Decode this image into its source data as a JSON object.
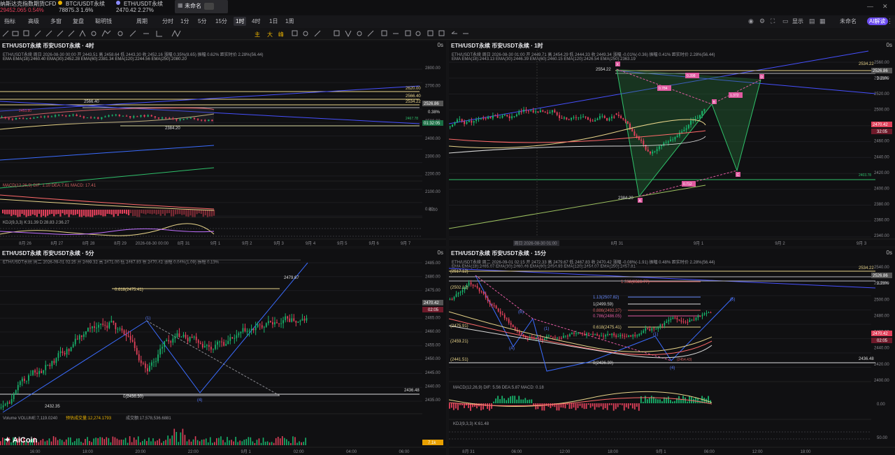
{
  "tickers": [
    {
      "name": "纳斯达克指数期货CFD",
      "price": "29452.065",
      "change": "0.54%",
      "color": "#e0405a"
    },
    {
      "name": "BTC/USDT永续",
      "price": "78875.3",
      "change": "1.6%",
      "color": "#d0d0d4"
    },
    {
      "name": "ETH/USDT永续",
      "price": "2470.42",
      "change": "2.27%",
      "color": "#d0d0d4"
    }
  ],
  "tab": {
    "label": "未命名"
  },
  "toolbar": {
    "items": [
      "指标",
      "高级",
      "多窗",
      "复盘",
      "聪明钱"
    ],
    "period": "周期",
    "timeframes": [
      "分时",
      "1分",
      "5分",
      "15分",
      "1时",
      "4时",
      "1日",
      "1周"
    ],
    "active_tf": "1时",
    "display": "显示",
    "layout": "未命名",
    "ai": "AI解读"
  },
  "panels": [
    {
      "title": "ETH/USDT永续 币安USDT永续 · 4时",
      "zoom": "0s",
      "info": "ETH/USDT永续  周日 2026-08-30 00:00  开 2443.51  高 2458.64  低 2443.30  收 2452.16  涨幅 0.35%(8.65)  振幅 0.62%  距实时价 2.28%(56.44)",
      "ema": "EMA  EMA(18):2460.40  EMA(30):2452.28  EMA(60):2381.34  EMA(120):2244.56  EMA(250):2080.20",
      "yticks": [
        "2800.00",
        "2700.00",
        "2600.00",
        "2500.00",
        "2400.00",
        "2300.00",
        "2200.00",
        "2100.00",
        "0.00"
      ],
      "xticks": [
        "8月 26",
        "8月 27",
        "8月 28",
        "8月 29",
        "2026-08-30 00:00",
        "8月 31",
        "9月 1",
        "9月 2",
        "9月 3",
        "9月 4",
        "9月 5",
        "9月 6",
        "9月 7"
      ],
      "labels": {
        "h": "2566.40",
        "l": "2384.20",
        "lvl1": "2620.00",
        "lvl2": "2566.40",
        "lvl3": "2534.22",
        "cur": "2526.86",
        "pct": "0.38%",
        "cd": "01:32:05",
        "lowp": "2467.78",
        "mid": "2453.80"
      },
      "macd": "MACD(12,26,9)  DIF: 1.10  DEA:7.61  MACD: 17.41",
      "kdj": "KDJ(9,3,3)  K:31.39  D:28.83  J:36.27"
    },
    {
      "title": "ETH/USDT永续 币安USDT永续 · 1时",
      "zoom": "0s",
      "info": "ETH/USDT永续  周日 2026-08-30 01:00  开 2449.71  高 2454.29  低 2444.33  收 2449.34  涨幅 -0.01%(-0.36)  振幅 0.41%  距实时价 2.28%(56.44)",
      "ema": "EMA  EMA(18):2443.13  EMA(30):2446.39  EMA(60):2460.15  EMA(120):2426.54  EMA(250):2363.19",
      "yticks": [
        "2560.00",
        "2540.00",
        "2520.00",
        "2500.00",
        "2480.00",
        "2460.00",
        "2440.00",
        "2420.00",
        "2400.00",
        "2380.00",
        "2360.00",
        "2340.00"
      ],
      "xticks": [
        "周日 2026-08-30 01:00",
        "8月 31",
        "9月 1",
        "9月 2",
        "9月 3"
      ],
      "labels": {
        "h": "2554.22",
        "l": "2384.20",
        "p1": "0.398",
        "p2": "0.784",
        "p3": "1.372",
        "p4": "0.712",
        "X": "X",
        "A": "A",
        "B": "B",
        "C": "C",
        "D": "D",
        "top": "2534.22",
        "cur": "2526.86",
        "pct": "2.28%",
        "price": "2470.42",
        "cd": "32:05",
        "low": "2403.78"
      }
    },
    {
      "title": "ETH/USDT永续 币安USDT永续 · 5分",
      "zoom": "0s",
      "info": "ETH/USDT永续  周二 2026-09-01 02:25  开 2469.32  高 2471.00  低 2467.83  收 2470.42  涨幅 0.04%(1.09)  振幅 0.13%",
      "yticks": [
        "2485.00",
        "2480.00",
        "2475.00",
        "2470.00",
        "2465.00",
        "2460.00",
        "2455.00",
        "2450.00",
        "2445.00",
        "2440.00",
        "2435.00"
      ],
      "xticks": [
        "16:00",
        "18:00",
        "20:00",
        "22:00",
        "9月 1",
        "02:00",
        "04:00",
        "06:00"
      ],
      "labels": {
        "fib618": "0.618(2475.41)",
        "fib0": "0(2436.30)",
        "hi": "2479.67",
        "lo": "2432.35",
        "w1": "(1)",
        "w4": "(4)",
        "cur": "2470.42",
        "cd": "02:05",
        "lvl": "2436.48",
        "vol": "7.1k"
      },
      "volume": "Volume  VOLUME:7,119.0240",
      "vol2": "预估成交量:12,274.1793",
      "vol3": "成交额:17,578,536.6881"
    },
    {
      "title": "ETH/USDT永续 币安USDT永续 · 15分",
      "zoom": "0s",
      "info": "ETH/USDT永续  周二 2026-09-01 02:15  开 2472.33  高 2479.67  低 2467.83  收 2470.42  涨幅 -0.08%(-1.91)  振幅 0.48%  距实时价 2.28%(56.44)",
      "ema": "EMA  EMA(18):2465.07  EMA(30):2460.46  EMA(60):2454.93  EMA(120):2454.07  EMA(250):2457.81",
      "yticks": [
        "2540.00",
        "2520.00",
        "2500.00",
        "2480.00",
        "2460.00",
        "2440.00",
        "2420.00",
        "2400.00",
        "0.00",
        "50.00"
      ],
      "xticks": [
        "8月 31",
        "06:00",
        "12:00",
        "18:00",
        "9月 1",
        "06:00",
        "12:00",
        "18:00"
      ],
      "fibs": [
        "1.382(2523.77)",
        "1.13(2507.82)",
        "1(2499.59)",
        "0.886(2492.37)",
        "0.786(2486.05)",
        "0.618(2475.41)",
        "0(2436.30)"
      ],
      "labels": {
        "top": "2534.22",
        "cur": "2526.86",
        "pct": "2.28%",
        "price": "2470.42",
        "cd": "02:05",
        "lvl": "2436.48",
        "a1": "(2517.12)",
        "a2": "(2502.12)",
        "a3": "(2475.91)",
        "a4": "(2459.21)",
        "a5": "(2441.51)",
        "a6": "(2454.43)",
        "a7": "2436.30",
        "w1": "(1)",
        "w2": "(2)",
        "w3": "(3)",
        "w4": "(4)",
        "w5": "(5)",
        "wA": "(A)",
        "wB": "(B)"
      },
      "macd": "MACD(12,26,9)  DIF: 5.56  DEA:5.87  MACD: 0.18",
      "kdj": "KDJ(9,3,3)  K:61.48"
    }
  ],
  "brand": "AiCoin",
  "colors": {
    "up": "#18b26b",
    "down": "#e0405a",
    "yellow": "#e8d48a",
    "blue": "#4650ff",
    "bg": "#101012"
  }
}
